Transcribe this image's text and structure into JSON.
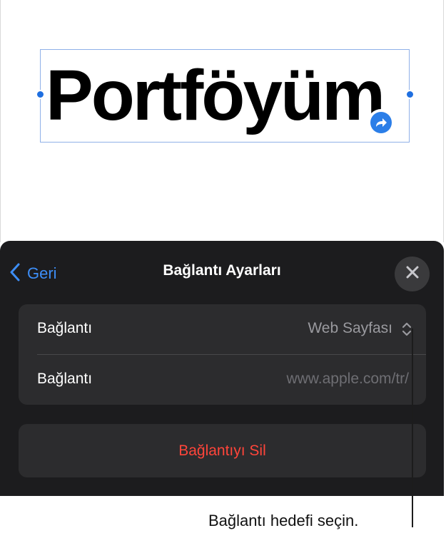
{
  "canvas": {
    "text": "Portföyüm"
  },
  "sheet": {
    "back_label": "Geri",
    "title": "Bağlantı Ayarları",
    "rows": [
      {
        "label": "Bağlantı",
        "value": "Web Sayfası"
      },
      {
        "label": "Bağlantı",
        "value": "www.apple.com/tr/"
      }
    ],
    "delete_label": "Bağlantıyı Sil"
  },
  "callout": {
    "text": "Bağlantı hedefi seçin."
  },
  "colors": {
    "accent": "#3d8ef7",
    "destructive": "#ff453a",
    "sheet_bg": "#1c1c1e",
    "group_bg": "#2c2c2e",
    "selection_handle": "#1f6fe0"
  },
  "icons": [
    "chevron-left-icon",
    "close-icon",
    "up-down-chevron-icon",
    "link-arrow-icon"
  ]
}
